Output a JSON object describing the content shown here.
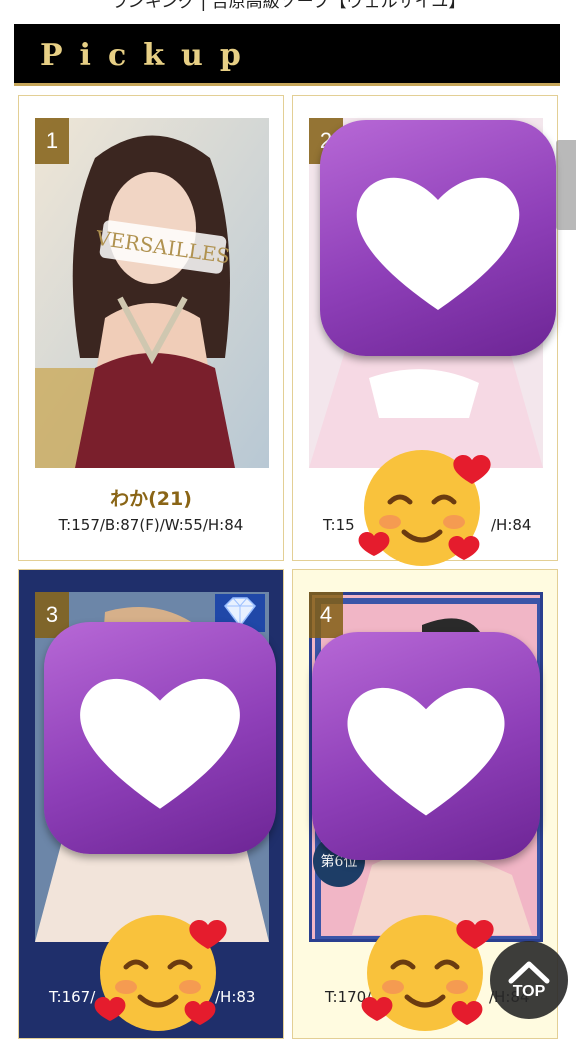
{
  "page": {
    "top_title": "ランキング | 吉原高級ソープ【ヴェルサイユ】",
    "section_title": "Pickup"
  },
  "cards": [
    {
      "rank": "1",
      "name": "わか",
      "age": "(21)",
      "stats": "T:157/B:87(F)/W:55/H:84",
      "watermark": "VERSAILLES"
    },
    {
      "rank": "2",
      "stats_left": "T:15",
      "stats_right": "/H:84"
    },
    {
      "rank": "3",
      "stats_left": "T:167/",
      "stats_right": "/H:83"
    },
    {
      "rank": "4",
      "stats_left": "T:170/",
      "stats_right": "/H:84",
      "rank_seal": "第6位"
    }
  ],
  "ui": {
    "top_button_label": "TOP",
    "icons": [
      "heart-sticker-icon",
      "smiling-face-hearts-icon",
      "chevron-up-icon",
      "diamond-icon"
    ]
  },
  "colors": {
    "header_bg": "#000000",
    "header_text": "#e7cf85",
    "gold_border": "#c6a65a",
    "name_text": "#8a6516",
    "sticker_purple": "#9b4fc4"
  }
}
